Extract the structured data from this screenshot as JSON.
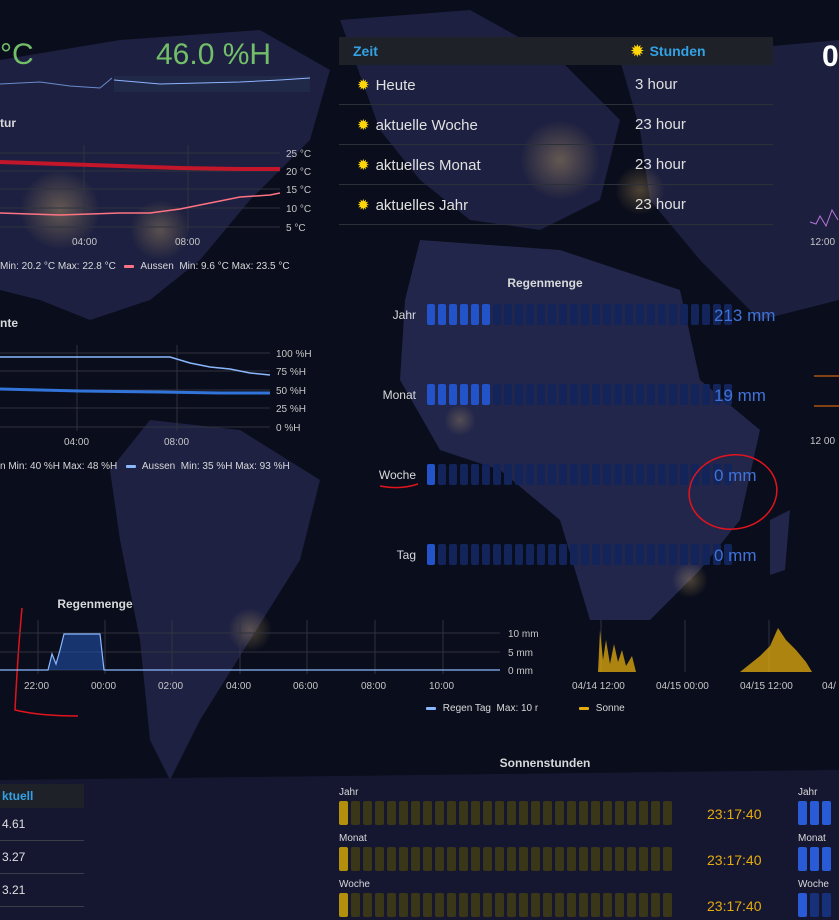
{
  "stats": {
    "temp_partial": "°C",
    "humidity": "46.0 %H",
    "right_partial": "0"
  },
  "temp_panel": {
    "title_partial": "tur",
    "y_ticks": [
      "25 °C",
      "20 °C",
      "15 °C",
      "10 °C",
      "5 °C"
    ],
    "x_ticks": [
      "04:00",
      "08:00"
    ],
    "legend_inner": "Min: 20.2 °C  Max: 22.8 °C",
    "legend_outer_name": "Aussen",
    "legend_outer_stats": "Min: 9.6 °C  Max: 23.5 °C"
  },
  "hum_panel": {
    "title_partial": "nte",
    "y_ticks": [
      "100 %H",
      "75 %H",
      "50 %H",
      "25 %H",
      "0 %H"
    ],
    "x_ticks": [
      "04:00",
      "08:00"
    ],
    "legend_inner": "n Min: 40 %H  Max: 48 %H",
    "legend_outer_name": "Aussen",
    "legend_outer_stats": "Min: 35 %H  Max: 93 %H"
  },
  "sun_table": {
    "headers": [
      "Zeit",
      "Stunden"
    ],
    "rows": [
      {
        "label": "Heute",
        "value": "3 hour"
      },
      {
        "label": "aktuelle Woche",
        "value": "23 hour"
      },
      {
        "label": "aktuelles Monat",
        "value": "23 hour"
      },
      {
        "label": "aktuelles Jahr",
        "value": "23 hour"
      }
    ]
  },
  "rain_gauge": {
    "title": "Regenmenge",
    "rows": [
      {
        "label": "Jahr",
        "value": "213 mm",
        "filled": 6
      },
      {
        "label": "Monat",
        "value": "19 mm",
        "filled": 6
      },
      {
        "label": "Woche",
        "value": "0 mm",
        "filled": 1
      },
      {
        "label": "Tag",
        "value": "0 mm",
        "filled": 1
      }
    ],
    "cells": 28
  },
  "rain_chart": {
    "title": "Regenmenge",
    "y_ticks": [
      "10 mm",
      "5 mm",
      "0 mm"
    ],
    "x_ticks": [
      "22:00",
      "00:00",
      "02:00",
      "04:00",
      "06:00",
      "08:00",
      "10:00"
    ],
    "legend_name": "Regen Tag",
    "legend_stats": "Max: 10 r"
  },
  "sun_chart": {
    "x_ticks": [
      "04/14 12:00",
      "04/15 00:00",
      "04/15 12:00",
      "04/"
    ],
    "legend_name": "Sonne"
  },
  "sunhours_gauge": {
    "title": "Sonnenstunden",
    "rows": [
      {
        "label": "Jahr",
        "value": "23:17:40"
      },
      {
        "label": "Monat",
        "value": "23:17:40"
      },
      {
        "label": "Woche",
        "value": "23:17:40"
      }
    ],
    "right_labels": [
      "Jahr",
      "Monat",
      "Woche"
    ]
  },
  "left_table": {
    "header": "ktuell",
    "rows": [
      "4.61",
      "3.27",
      "3.21"
    ]
  },
  "right_edge": {
    "tick1": "12:00",
    "tick2": "12 00"
  },
  "colors": {
    "accent": "#33a2e5",
    "humidity": "#73bf69",
    "rain": "#2353c9",
    "sun": "#e5ac0e",
    "temp_inner": "#c4162a",
    "temp_outer": "#ff7383"
  }
}
